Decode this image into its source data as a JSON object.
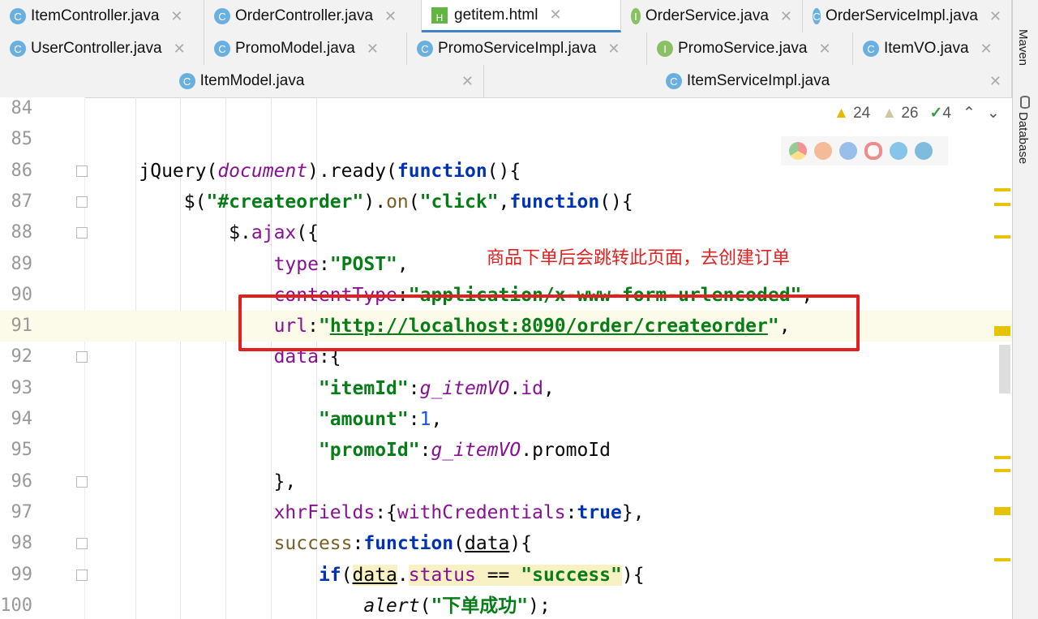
{
  "tabs": {
    "row1": [
      {
        "label": "ItemController.java",
        "icon": "class"
      },
      {
        "label": "OrderController.java",
        "icon": "class"
      },
      {
        "label": "getitem.html",
        "icon": "html",
        "active": true
      },
      {
        "label": "OrderService.java",
        "icon": "interface"
      },
      {
        "label": "OrderServiceImpl.java",
        "icon": "class"
      }
    ],
    "row2": [
      {
        "label": "UserController.java",
        "icon": "class"
      },
      {
        "label": "PromoModel.java",
        "icon": "class"
      },
      {
        "label": "PromoServiceImpl.java",
        "icon": "class"
      },
      {
        "label": "PromoService.java",
        "icon": "interface"
      },
      {
        "label": "ItemVO.java",
        "icon": "class"
      }
    ],
    "row3": [
      {
        "label": "ItemModel.java",
        "icon": "class"
      },
      {
        "label": "ItemServiceImpl.java",
        "icon": "class"
      }
    ]
  },
  "right_sidebar": {
    "maven": "Maven",
    "database": "Database"
  },
  "inspections": {
    "warnings": "24",
    "weak_warnings": "26",
    "typos": "4"
  },
  "annotation": "商品下单后会跳转此页面，去创建订单",
  "code": [
    {
      "n": "84",
      "fold": false,
      "t": []
    },
    {
      "n": "85",
      "fold": false,
      "t": []
    },
    {
      "n": "86",
      "fold": true,
      "t": [
        [
          "    jQuery(",
          ""
        ],
        [
          "document",
          "var"
        ],
        [
          ").ready(",
          ""
        ],
        [
          "function",
          "kw"
        ],
        [
          "(){",
          ""
        ]
      ]
    },
    {
      "n": "87",
      "fold": true,
      "t": [
        [
          "        $(",
          ""
        ],
        [
          "\"#createorder\"",
          "str"
        ],
        [
          ").",
          ""
        ],
        [
          "on",
          "fn"
        ],
        [
          "(",
          ""
        ],
        [
          "\"click\"",
          "str"
        ],
        [
          ",",
          ""
        ],
        [
          "function",
          "kw"
        ],
        [
          "(){",
          ""
        ]
      ]
    },
    {
      "n": "88",
      "fold": true,
      "t": [
        [
          "            $.",
          ""
        ],
        [
          "ajax",
          "prop"
        ],
        [
          "({",
          ""
        ]
      ]
    },
    {
      "n": "89",
      "fold": false,
      "t": [
        [
          "                ",
          ""
        ],
        [
          "type",
          "prop"
        ],
        [
          ":",
          ""
        ],
        [
          "\"POST\"",
          "str"
        ],
        [
          ",",
          ""
        ]
      ]
    },
    {
      "n": "90",
      "fold": false,
      "t": [
        [
          "                ",
          ""
        ],
        [
          "contentType",
          "prop"
        ],
        [
          ":",
          ""
        ],
        [
          "\"application/x-www-form-urlencoded\"",
          "str"
        ],
        [
          ",",
          ""
        ]
      ]
    },
    {
      "n": "91",
      "fold": false,
      "cur": true,
      "t": [
        [
          "                ",
          ""
        ],
        [
          "url",
          "prop"
        ],
        [
          ":",
          ""
        ],
        [
          "\"",
          "str"
        ],
        [
          "http://localhost:8090/order/createorder",
          "str ul"
        ],
        [
          "\"",
          "str"
        ],
        [
          ",",
          ""
        ]
      ]
    },
    {
      "n": "92",
      "fold": true,
      "t": [
        [
          "                ",
          ""
        ],
        [
          "data",
          "prop"
        ],
        [
          ":{",
          ""
        ]
      ]
    },
    {
      "n": "93",
      "fold": false,
      "t": [
        [
          "                    ",
          ""
        ],
        [
          "\"itemId\"",
          "str"
        ],
        [
          ":",
          ""
        ],
        [
          "g_itemVO",
          "var"
        ],
        [
          ".",
          ""
        ],
        [
          "id",
          "prop"
        ],
        [
          ",",
          ""
        ]
      ]
    },
    {
      "n": "94",
      "fold": false,
      "t": [
        [
          "                    ",
          ""
        ],
        [
          "\"amount\"",
          "str"
        ],
        [
          ":",
          ""
        ],
        [
          "1",
          "num"
        ],
        [
          ",",
          ""
        ]
      ]
    },
    {
      "n": "95",
      "fold": false,
      "t": [
        [
          "                    ",
          ""
        ],
        [
          "\"promoId\"",
          "str"
        ],
        [
          ":",
          ""
        ],
        [
          "g_itemVO",
          "var"
        ],
        [
          ".promoId",
          ""
        ]
      ]
    },
    {
      "n": "96",
      "fold": true,
      "t": [
        [
          "                },",
          ""
        ]
      ]
    },
    {
      "n": "97",
      "fold": false,
      "t": [
        [
          "                ",
          ""
        ],
        [
          "xhrFields",
          "prop"
        ],
        [
          ":{",
          ""
        ],
        [
          "withCredentials",
          "prop"
        ],
        [
          ":",
          ""
        ],
        [
          "true",
          "kw"
        ],
        [
          "},",
          ""
        ]
      ]
    },
    {
      "n": "98",
      "fold": true,
      "t": [
        [
          "                ",
          ""
        ],
        [
          "success",
          "fn"
        ],
        [
          ":",
          ""
        ],
        [
          "function",
          "kw"
        ],
        [
          "(",
          ""
        ],
        [
          "data",
          "ul"
        ],
        [
          "){",
          ""
        ]
      ]
    },
    {
      "n": "99",
      "fold": true,
      "t": [
        [
          "                    ",
          ""
        ],
        [
          "if",
          "kw"
        ],
        [
          "(",
          ""
        ],
        [
          "data",
          "ul hl"
        ],
        [
          ".",
          ""
        ],
        [
          "status",
          "prop hl"
        ],
        [
          " == ",
          "hl"
        ],
        [
          "\"success\"",
          "str hl"
        ],
        [
          "){",
          ""
        ]
      ]
    },
    {
      "n": "100",
      "fold": false,
      "t": [
        [
          "                        ",
          ""
        ],
        [
          "alert",
          "it"
        ],
        [
          "(",
          ""
        ],
        [
          "\"下单成功\"",
          "str"
        ],
        [
          ");",
          ""
        ]
      ]
    }
  ]
}
